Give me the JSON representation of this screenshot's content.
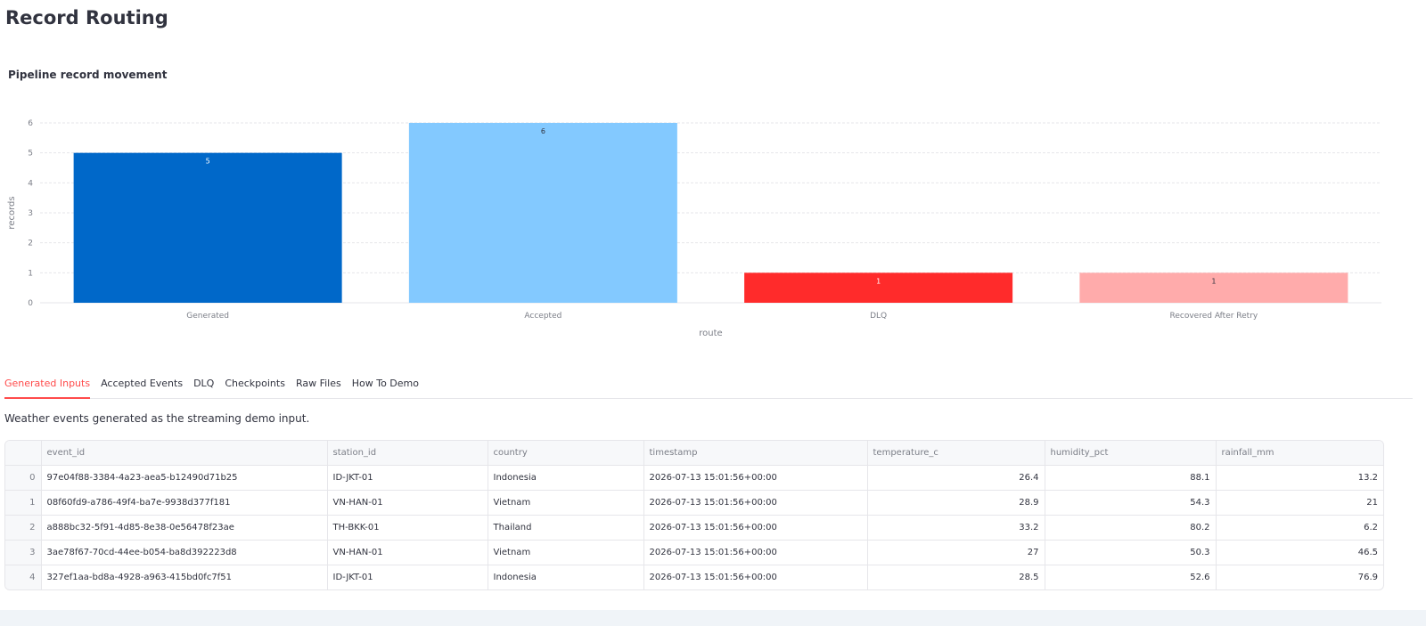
{
  "page": {
    "title": "Record Routing"
  },
  "chart_data": {
    "type": "bar",
    "title": "Pipeline record movement",
    "categories": [
      "Generated",
      "Accepted",
      "DLQ",
      "Recovered After Retry"
    ],
    "values": [
      5,
      6,
      1,
      1
    ],
    "colors": [
      "#0068c9",
      "#83c9ff",
      "#ff2b2b",
      "#ffabab"
    ],
    "xlabel": "route",
    "ylabel": "records",
    "ylim": [
      0,
      6
    ],
    "yticks": [
      0,
      1,
      2,
      3,
      4,
      5,
      6
    ],
    "grid": true
  },
  "tabs": [
    {
      "label": "Generated Inputs",
      "active": true
    },
    {
      "label": "Accepted Events",
      "active": false
    },
    {
      "label": "DLQ",
      "active": false
    },
    {
      "label": "Checkpoints",
      "active": false
    },
    {
      "label": "Raw Files",
      "active": false
    },
    {
      "label": "How To Demo",
      "active": false
    }
  ],
  "description": "Weather events generated as the streaming demo input.",
  "table": {
    "columns": [
      "",
      "event_id",
      "station_id",
      "country",
      "timestamp",
      "temperature_c",
      "humidity_pct",
      "rainfall_mm"
    ],
    "rows": [
      [
        "0",
        "97e04f88-3384-4a23-aea5-b12490d71b25",
        "ID-JKT-01",
        "Indonesia",
        "2026-07-13 15:01:56+00:00",
        "26.4",
        "88.1",
        "13.2"
      ],
      [
        "1",
        "08f60fd9-a786-49f4-ba7e-9938d377f181",
        "VN-HAN-01",
        "Vietnam",
        "2026-07-13 15:01:56+00:00",
        "28.9",
        "54.3",
        "21"
      ],
      [
        "2",
        "a888bc32-5f91-4d85-8e38-0e56478f23ae",
        "TH-BKK-01",
        "Thailand",
        "2026-07-13 15:01:56+00:00",
        "33.2",
        "80.2",
        "6.2"
      ],
      [
        "3",
        "3ae78f67-70cd-44ee-b054-ba8d392223d8",
        "VN-HAN-01",
        "Vietnam",
        "2026-07-13 15:01:56+00:00",
        "27",
        "50.3",
        "46.5"
      ],
      [
        "4",
        "327ef1aa-bd8a-4928-a963-415bd0fc7f51",
        "ID-JKT-01",
        "Indonesia",
        "2026-07-13 15:01:56+00:00",
        "28.5",
        "52.6",
        "76.9"
      ]
    ]
  }
}
